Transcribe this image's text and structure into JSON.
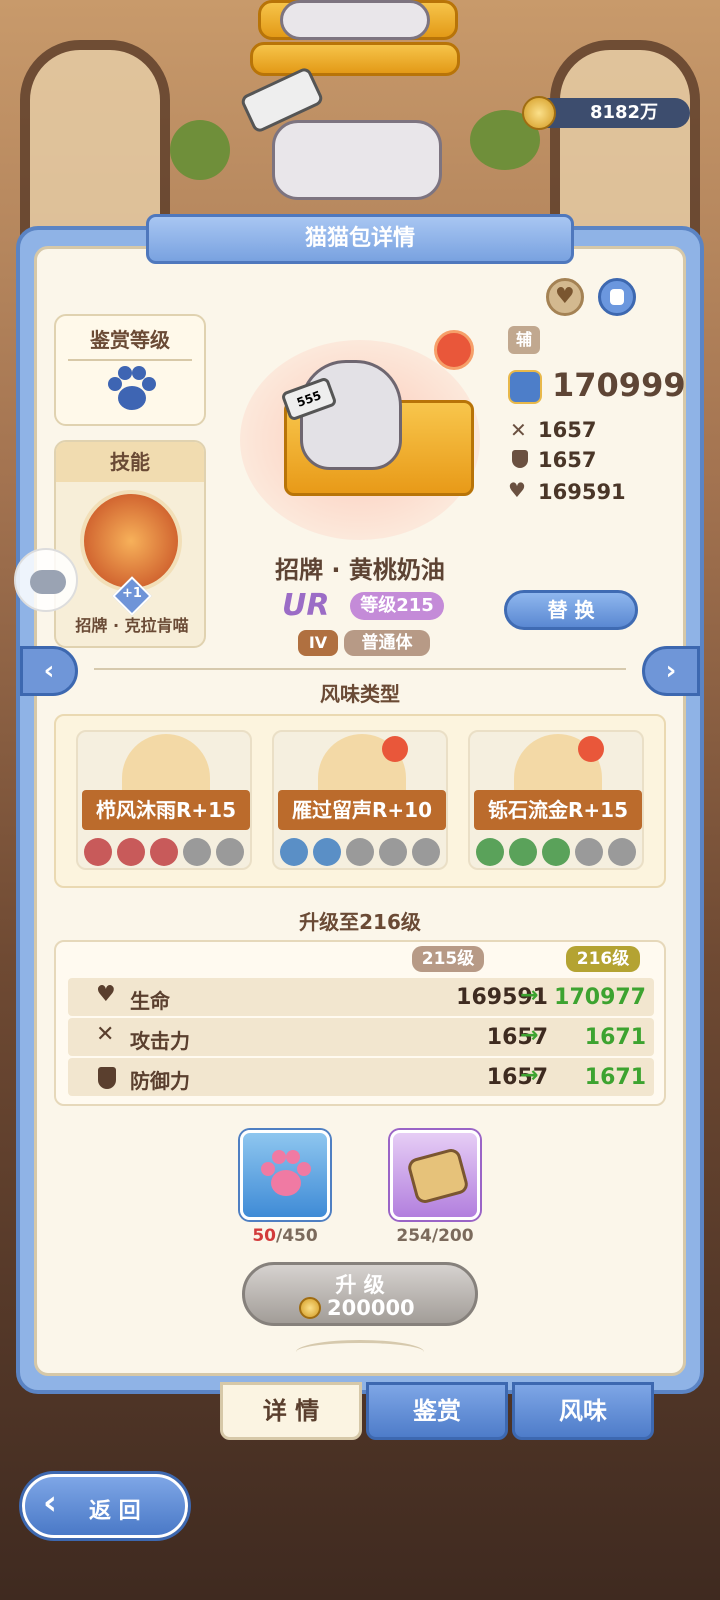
{
  "currency": {
    "amount": "8182万",
    "icon": "coin-icon"
  },
  "panel": {
    "title": "猫猫包详情"
  },
  "appraisal": {
    "title": "鉴赏等级",
    "icon": "paw-icon"
  },
  "skill": {
    "title": "技能",
    "name": "招牌 · 克拉肯喵",
    "badge": "+1"
  },
  "cat": {
    "name": "招牌 · 黄桃奶油",
    "rarity": "UR",
    "level": "等级215",
    "tier": "IV",
    "body": "普通体",
    "role": "辅",
    "tag_number": "555"
  },
  "stats": {
    "power": "170999",
    "attack": "1657",
    "defense": "1657",
    "hp": "169591"
  },
  "replace_label": "替 换",
  "flavor": {
    "title": "风味类型",
    "items": [
      {
        "label": "栉风沐雨R+15",
        "dots": [
          "#c66",
          "#c66",
          "#c66",
          "#999",
          "#999"
        ]
      },
      {
        "label": "雁过留声R+10",
        "dots": [
          "#5a8fc6",
          "#5a8fc6",
          "#999",
          "#999",
          "#999"
        ]
      },
      {
        "label": "铄石流金R+15",
        "dots": [
          "#5aa25a",
          "#5aa25a",
          "#5aa25a",
          "#999",
          "#999"
        ]
      }
    ]
  },
  "upgrade": {
    "title": "升级至216级",
    "col_current": "215级",
    "col_next": "216级",
    "rows": [
      {
        "name": "生命",
        "current": "169591",
        "next": "170977",
        "icon": "heart-icon"
      },
      {
        "name": "攻击力",
        "current": "1657",
        "next": "1671",
        "icon": "swords-icon"
      },
      {
        "name": "防御力",
        "current": "1657",
        "next": "1671",
        "icon": "shield-icon"
      }
    ]
  },
  "materials": [
    {
      "have": "50",
      "need": "/450",
      "icon": "pink-paw-icon"
    },
    {
      "have": "254",
      "need": "/200",
      "icon": "toast-icon"
    }
  ],
  "upgrade_button": {
    "label": "升 级",
    "cost": "200000"
  },
  "tabs": [
    "详 情",
    "鉴赏",
    "风味"
  ],
  "back_label": "返 回",
  "colors": {
    "accent": "#5b84c4",
    "panel": "#fbf6ea",
    "green": "#3da330",
    "brown": "#bb6b2c"
  }
}
